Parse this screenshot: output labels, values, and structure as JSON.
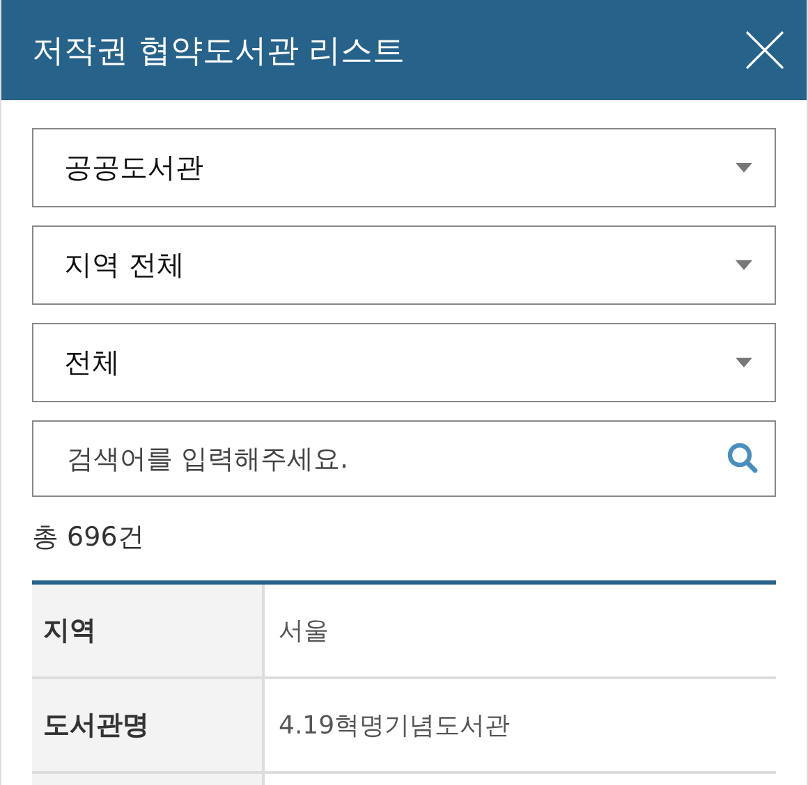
{
  "window": {
    "title": "저작권 협약도서관 리스트"
  },
  "filters": [
    {
      "value": "공공도서관"
    },
    {
      "value": "지역 전체"
    },
    {
      "value": "전체"
    }
  ],
  "search": {
    "placeholder": "검색어를 입력해주세요."
  },
  "count": "총 696건",
  "table": {
    "rows": [
      {
        "label": "지역",
        "value": "서울"
      },
      {
        "label": "도서관명",
        "value": "4.19혁명기념도서관"
      }
    ]
  }
}
